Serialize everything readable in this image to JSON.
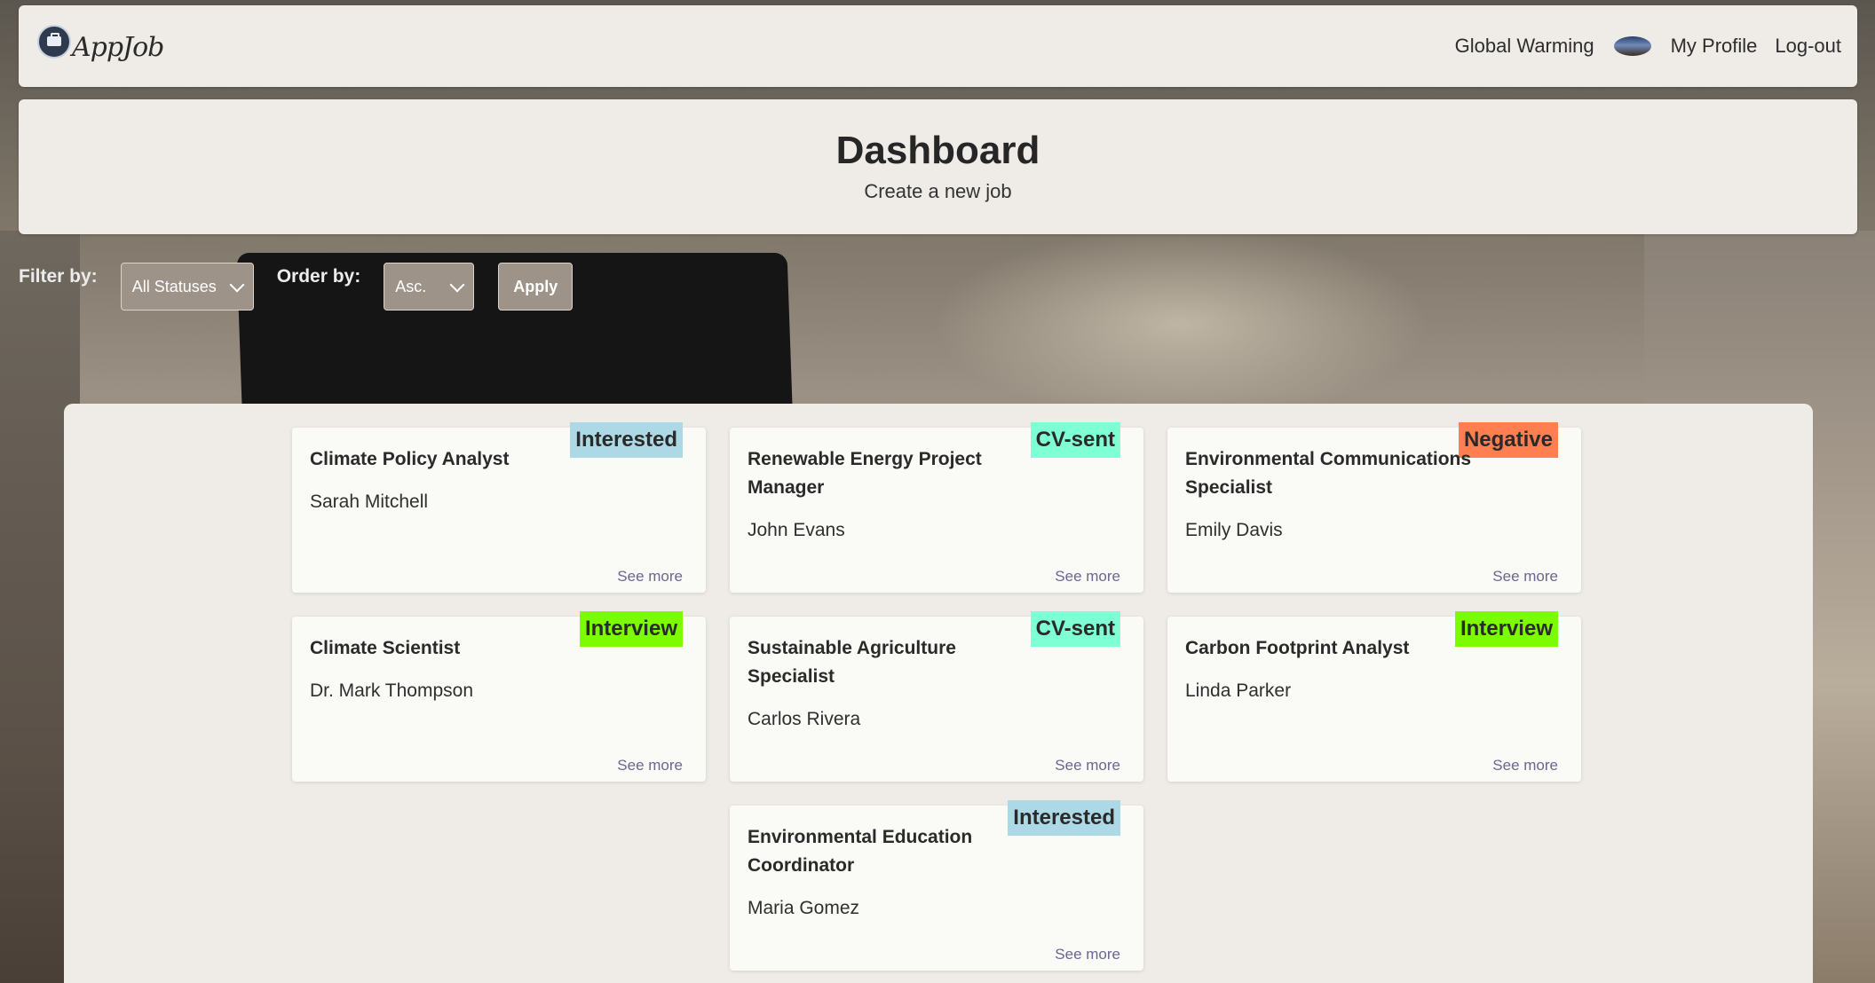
{
  "nav": {
    "logo_text": "AppJob",
    "user_name": "Global Warming",
    "profile_label": "My Profile",
    "logout_label": "Log-out"
  },
  "header": {
    "title": "Dashboard",
    "create_link": "Create a new job"
  },
  "filters": {
    "filter_label": "Filter by:",
    "status_value": "All Statuses",
    "order_label": "Order by:",
    "order_value": "Asc.",
    "apply_label": "Apply"
  },
  "status_colors": {
    "Interested": "#add8e6",
    "CV-sent": "#7fffd4",
    "Negative": "#ff7f50",
    "Interview": "#7cfc00"
  },
  "jobs": [
    {
      "title": "Climate Policy Analyst",
      "person": "Sarah Mitchell",
      "status": "Interested",
      "link": "See more"
    },
    {
      "title": "Renewable Energy Project Manager",
      "person": "John Evans",
      "status": "CV-sent",
      "link": "See more"
    },
    {
      "title": "Environmental Communications Specialist",
      "person": "Emily Davis",
      "status": "Negative",
      "link": "See more"
    },
    {
      "title": "Climate Scientist",
      "person": "Dr. Mark Thompson",
      "status": "Interview",
      "link": "See more"
    },
    {
      "title": "Sustainable Agriculture Specialist",
      "person": "Carlos Rivera",
      "status": "CV-sent",
      "link": "See more"
    },
    {
      "title": "Carbon Footprint Analyst",
      "person": "Linda Parker",
      "status": "Interview",
      "link": "See more"
    },
    {
      "title": "Environmental Education Coordinator",
      "person": "Maria Gomez",
      "status": "Interested",
      "link": "See more"
    }
  ]
}
